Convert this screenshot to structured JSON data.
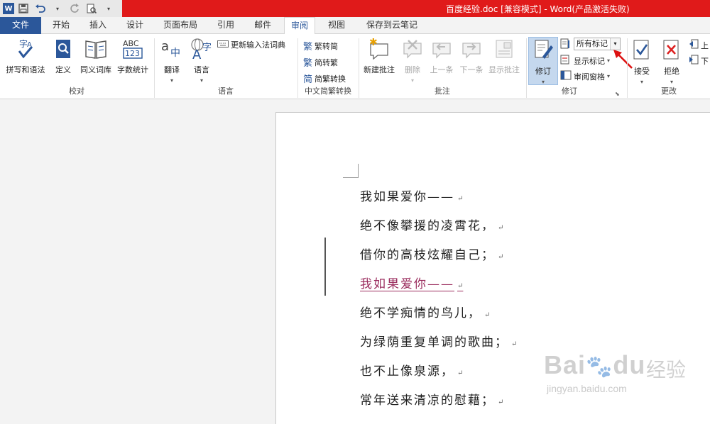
{
  "window": {
    "title": "百度经验.doc [兼容模式] - Word(产品激活失败)"
  },
  "tabs": [
    {
      "label": "文件"
    },
    {
      "label": "开始"
    },
    {
      "label": "插入"
    },
    {
      "label": "设计"
    },
    {
      "label": "页面布局"
    },
    {
      "label": "引用"
    },
    {
      "label": "邮件"
    },
    {
      "label": "审阅"
    },
    {
      "label": "视图"
    },
    {
      "label": "保存到云笔记"
    }
  ],
  "active_tab": "审阅",
  "ribbon": {
    "proofing": {
      "label": "校对",
      "spell": "拼写和语法",
      "define": "定义",
      "thesaurus": "同义词库",
      "wordcount": "字数统计",
      "abc": "ABC",
      "num": "123",
      "zi": "字"
    },
    "language": {
      "label": "语言",
      "translate": "翻译",
      "language": "语言",
      "update_ime": "更新输入法词典"
    },
    "chinese": {
      "label": "中文简繁转换",
      "t2s": "繁转简",
      "s2t": "简转繁",
      "convert": "简繁转换"
    },
    "comments": {
      "label": "批注",
      "new": "新建批注",
      "delete": "删除",
      "prev": "上一条",
      "next": "下一条",
      "show": "显示批注"
    },
    "tracking": {
      "label": "修订",
      "track": "修订",
      "markup_value": "所有标记",
      "show_markup": "显示标记",
      "review_pane": "审阅窗格"
    },
    "changes": {
      "label": "更改",
      "accept": "接受",
      "reject": "拒绝",
      "prev": "上",
      "next": "下"
    }
  },
  "document": {
    "lines": [
      {
        "text": "我如果爱你——",
        "revision": false
      },
      {
        "text": "绝不像攀援的凌霄花，",
        "revision": false
      },
      {
        "text": "借你的高枝炫耀自己；",
        "revision": false
      },
      {
        "text": "我如果爱你——",
        "revision": true
      },
      {
        "text": "绝不学痴情的鸟儿，",
        "revision": false
      },
      {
        "text": "为绿荫重复单调的歌曲；",
        "revision": false
      },
      {
        "text": "也不止像泉源，",
        "revision": false
      },
      {
        "text": "常年送来清凉的慰藉；",
        "revision": false
      }
    ],
    "paragraph_mark": "↵"
  },
  "watermark": {
    "brand": "Bai",
    "brand2": "du",
    "cn": "经验",
    "url": "jingyan.baidu.com"
  },
  "colors": {
    "accent": "#2b579a",
    "titlebar_red": "#e01a1a",
    "revision": "#9b2d5e"
  },
  "icons": [
    "word-logo-icon",
    "save-icon",
    "undo-icon",
    "redo-icon",
    "print-preview-icon",
    "customize-icon"
  ]
}
